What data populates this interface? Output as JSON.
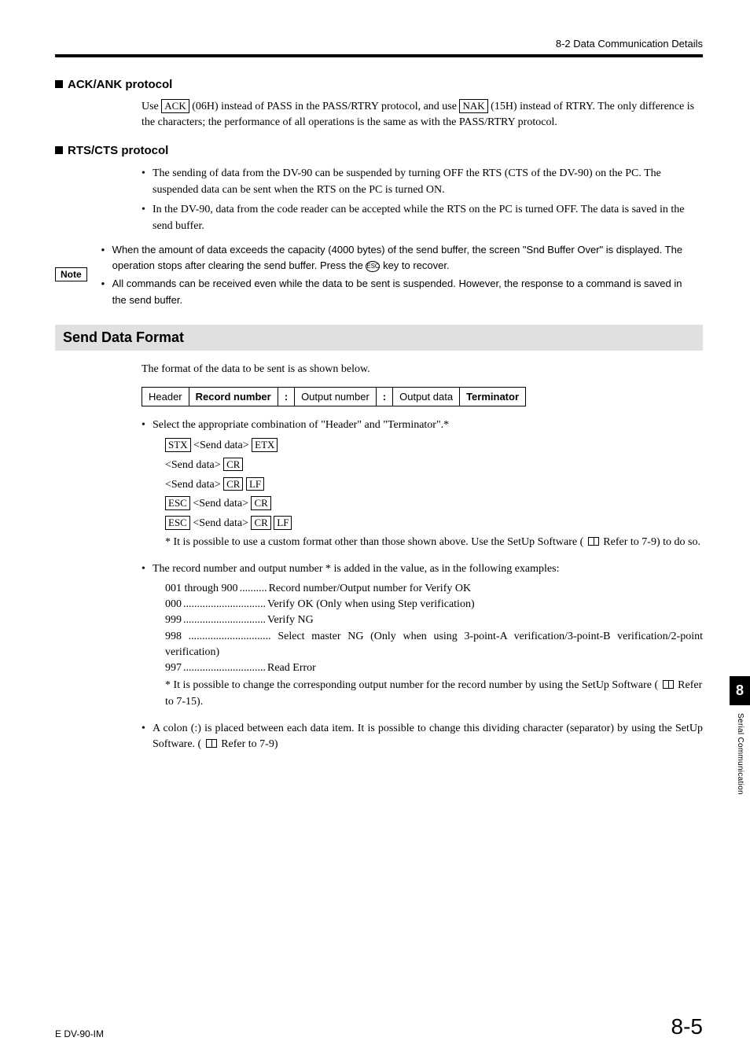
{
  "header": {
    "section_ref": "8-2  Data Communication Details"
  },
  "ack": {
    "title": "ACK/ANK protocol",
    "para": {
      "p1a": "Use ",
      "ack": "ACK",
      "p1b": " (06H) instead of PASS in the PASS/RTRY protocol, and use ",
      "nak": "NAK",
      "p1c": " (15H) instead of RTRY. The only difference is the characters; the performance of all operations is the same as with the PASS/RTRY protocol."
    }
  },
  "rts": {
    "title": "RTS/CTS protocol",
    "bullets": [
      "The sending of data from the DV-90 can be suspended by turning OFF the RTS (CTS of the DV-90) on the PC. The suspended data can be sent when the RTS on the PC is turned ON.",
      "In the DV-90, data from the code reader can be accepted while the RTS on the PC is turned OFF. The data is saved in the send buffer."
    ]
  },
  "note": {
    "label": "Note",
    "items": [
      {
        "a": "When the amount of data exceeds the capacity (4000 bytes) of the send buffer, the screen \"Snd Buffer Over\" is displayed. The operation stops after clearing the send buffer. Press the ",
        "key": "ESC",
        "b": " key to recover."
      },
      {
        "a": "All commands can be received even while the data to be sent is suspended. However, the response to a command is saved in the send buffer."
      }
    ]
  },
  "send": {
    "title": "Send Data Format",
    "intro": "The format of the data to be sent is as shown below.",
    "table": [
      "Header",
      "Record number",
      ":",
      "Output number",
      ":",
      "Output data",
      "Terminator"
    ],
    "b1": "Select the appropriate combination of \"Header\" and \"Terminator\".*",
    "combos": {
      "stx": "STX",
      "etx": "ETX",
      "cr": "CR",
      "lf": "LF",
      "esc": "ESC",
      "sd": "<Send data>"
    },
    "star1a": "* It is possible to use a custom format other than those shown above. Use the SetUp Software ( ",
    "star1b": " Refer to 7-9) to do so.",
    "b2": "The record number and output number * is added in the value, as in the following examples:",
    "records": [
      {
        "k": "001 through 900",
        "v": "Record number/Output number for Verify OK"
      },
      {
        "k": "000",
        "v": "Verify OK (Only when using Step verification)"
      },
      {
        "k": "999",
        "v": "Verify NG"
      },
      {
        "k": "998",
        "v": "Select master NG (Only when using 3-point-A verification/3-point-B verification/2-point verification)"
      },
      {
        "k": "997",
        "v": "Read Error"
      }
    ],
    "star2a": "* It is possible to change the corresponding output number for the record number by using the SetUp Software ( ",
    "star2b": " Refer to 7-15).",
    "b3a": "A colon (:) is placed between each data item. It is possible to change this dividing character (separator) by using the SetUp Software. ( ",
    "b3b": " Refer to 7-9)"
  },
  "sidebar": {
    "num": "8",
    "label": "Serial Communication"
  },
  "footer": {
    "left": "E DV-90-IM",
    "right": "8-5"
  }
}
